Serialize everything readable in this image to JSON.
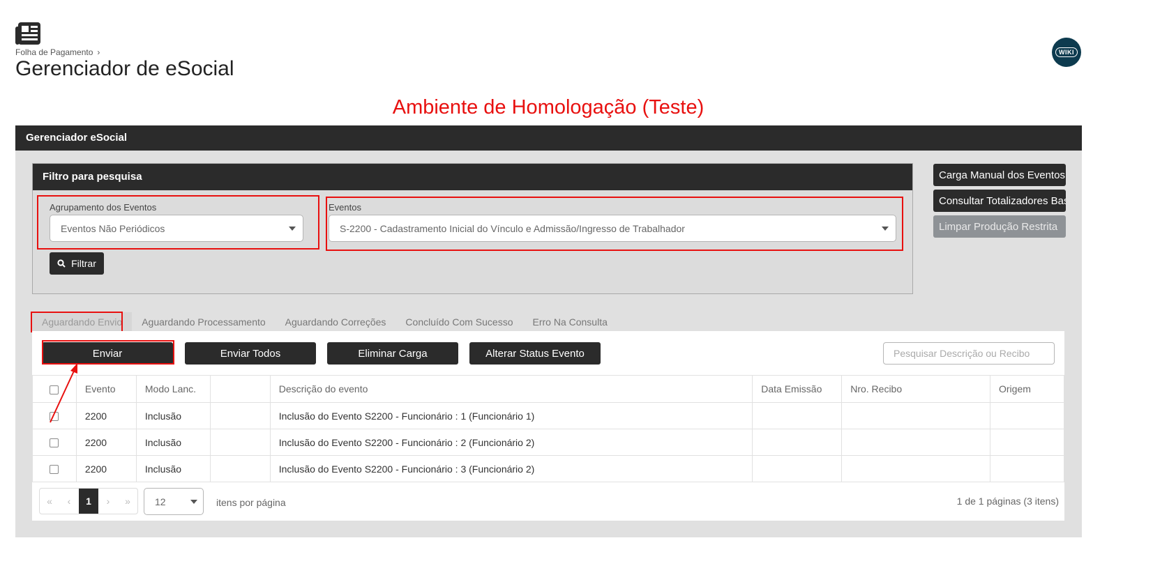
{
  "header": {
    "breadcrumb": "Folha de Pagamento",
    "title": "Gerenciador de eSocial",
    "wiki_label": "WIKI"
  },
  "environment_banner": "Ambiente de Homologação (Teste)",
  "panel": {
    "title": "Gerenciador eSocial"
  },
  "filter": {
    "title": "Filtro para pesquisa",
    "grouping_label": "Agrupamento dos Eventos",
    "grouping_value": "Eventos Não Periódicos",
    "events_label": "Eventos",
    "events_value": "S-2200 - Cadastramento Inicial do Vínculo e Admissão/Ingresso de Trabalhador",
    "filter_button": "Filtrar"
  },
  "side_actions": [
    {
      "label": "Carga Manual dos Eventos"
    },
    {
      "label": "Consultar Totalizadores Base"
    },
    {
      "label": "Limpar Produção Restrita"
    }
  ],
  "tabs": [
    {
      "label": "Aguardando Envio"
    },
    {
      "label": "Aguardando Processamento"
    },
    {
      "label": "Aguardando Correções"
    },
    {
      "label": "Concluído Com Sucesso"
    },
    {
      "label": "Erro Na Consulta"
    }
  ],
  "actions": {
    "send": "Enviar",
    "send_all": "Enviar Todos",
    "delete_load": "Eliminar Carga",
    "change_status": "Alterar Status Evento",
    "search_placeholder": "Pesquisar Descrição ou Recibo"
  },
  "table": {
    "columns": [
      "Evento",
      "Modo Lanc.",
      "",
      "Descrição do evento",
      "Data Emissão",
      "Nro. Recibo",
      "Origem"
    ],
    "rows": [
      {
        "evento": "2200",
        "modo": "Inclusão",
        "descricao": "Inclusão do Evento S2200 - Funcionário : 1 (Funcionário 1)",
        "data": "",
        "recibo": "",
        "origem": ""
      },
      {
        "evento": "2200",
        "modo": "Inclusão",
        "descricao": "Inclusão do Evento S2200 - Funcionário : 2 (Funcionário 2)",
        "data": "",
        "recibo": "",
        "origem": ""
      },
      {
        "evento": "2200",
        "modo": "Inclusão",
        "descricao": "Inclusão do Evento S2200 - Funcionário : 3 (Funcionário 2)",
        "data": "",
        "recibo": "",
        "origem": ""
      }
    ]
  },
  "pagination": {
    "first": "«",
    "prev": "‹",
    "current_page": "1",
    "next": "›",
    "last": "»",
    "page_size": "12",
    "per_page_label": "itens por página",
    "info": "1 de 1 páginas (3 itens)"
  },
  "colors": {
    "dark": "#2b2b2b",
    "highlight": "#e8100f",
    "disabled": "#8e9296"
  }
}
